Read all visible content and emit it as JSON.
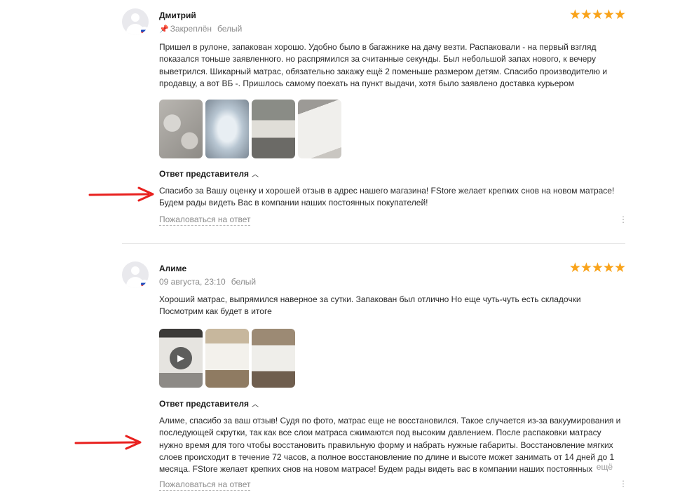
{
  "reviews": [
    {
      "author": "Дмитрий",
      "pinned": "Закреплён",
      "color": "белый",
      "date": "",
      "rating": 5,
      "stars": "★★★★★",
      "text": "Пришел в рулоне, запакован хорошо. Удобно было в багажнике на дачу везти. Распаковали - на первый взгляд показался тоньше заявленного. но распрямился за считанные секунды. Был небольшой запах нового, к вечеру выветрился. Шикарный матрас, обязательно закажу ещё 2 поменьше размером детям. Спасибо производителю и продавцу, а вот ВБ -. Пришлось самому поехать на пункт выдачи, хотя было заявлено доставка курьером",
      "reply_title": "Ответ представителя",
      "reply_text": "Спасибо за Вашу оценку и хорошей отзыв в адрес нашего магазина! FStore желает крепких снов на новом матрасе! Будем рады видеть Вас в компании наших постоянных покупателей!",
      "complain": "Пожаловаться на ответ"
    },
    {
      "author": "Алиме",
      "date": "09 августа, 23:10",
      "color": "белый",
      "rating": 5,
      "stars": "★★★★★",
      "text": "Хороший матрас, выпрямился наверное за сутки. Запакован был отлично Но еще чуть-чуть есть складочки Посмотрим как будет в итоге",
      "reply_title": "Ответ представителя",
      "reply_text": "Алиме, спасибо за ваш отзыв! Судя по фото, матрас еще не восстановился. Такое случается из-за вакуумирования и последующей скрутки, так как все слои матраса сжимаются под высоким давлением. После распаковки матрасу нужно время для того чтобы восстановить правильную форму и набрать нужные габариты. Восстановление мягких слоев происходит в течение 72 часов, а полное восстановление по длине и высоте может занимать от 14 дней до 1 месяца. FStore желает крепких снов на новом матрасе! Будем рады видеть вас в компании наших постоянных",
      "reply_more": "ещё",
      "complain": "Пожаловаться на ответ"
    }
  ],
  "icons": {
    "pin": "pin-icon",
    "play": "play-icon",
    "more": "more-vertical-icon",
    "chevron": "chevron-up-icon"
  },
  "colors": {
    "star": "#f9a31a",
    "arrow": "#e8201e",
    "muted": "#8b8b8b"
  }
}
